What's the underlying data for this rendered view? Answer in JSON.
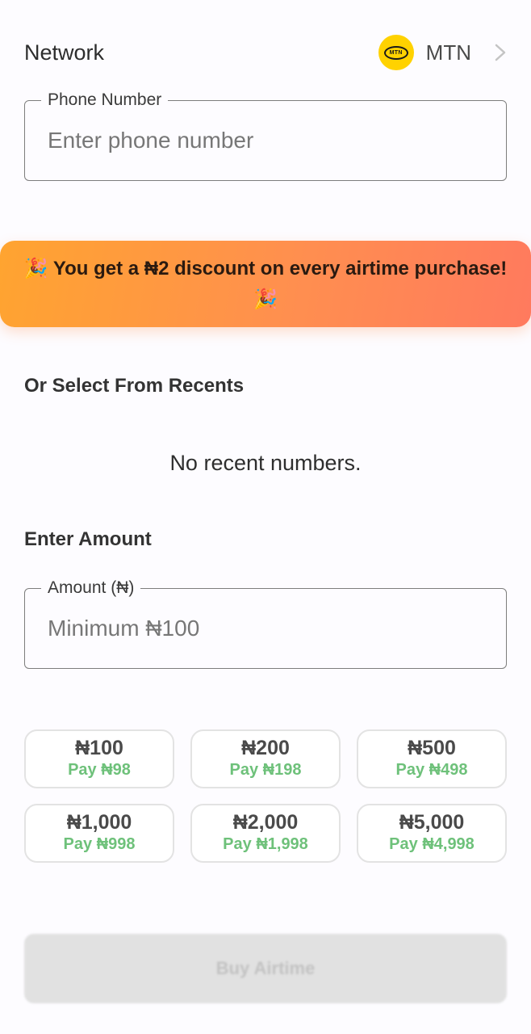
{
  "network": {
    "label": "Network",
    "logo_text": "MTN",
    "selected": "MTN",
    "logo_color": "#ffd200"
  },
  "phone": {
    "label": "Phone Number",
    "placeholder": "Enter phone number",
    "value": ""
  },
  "promo": {
    "emoji": "🎉",
    "text": "You get a ₦2 discount on every airtime purchase!",
    "gradient": [
      "#ffa430",
      "#ff7a5e"
    ]
  },
  "recents": {
    "title": "Or Select From Recents",
    "empty_message": "No recent numbers."
  },
  "amount": {
    "title": "Enter Amount",
    "label": "Amount (₦)",
    "placeholder": "Minimum ₦100",
    "value": ""
  },
  "quick_amounts": [
    {
      "amount": "₦100",
      "pay": "Pay ₦98"
    },
    {
      "amount": "₦200",
      "pay": "Pay ₦198"
    },
    {
      "amount": "₦500",
      "pay": "Pay ₦498"
    },
    {
      "amount": "₦1,000",
      "pay": "Pay ₦998"
    },
    {
      "amount": "₦2,000",
      "pay": "Pay ₦1,998"
    },
    {
      "amount": "₦5,000",
      "pay": "Pay ₦4,998"
    }
  ],
  "pay_color": "#6ec17a",
  "buy_button": {
    "label": "Buy Airtime",
    "enabled": false
  }
}
